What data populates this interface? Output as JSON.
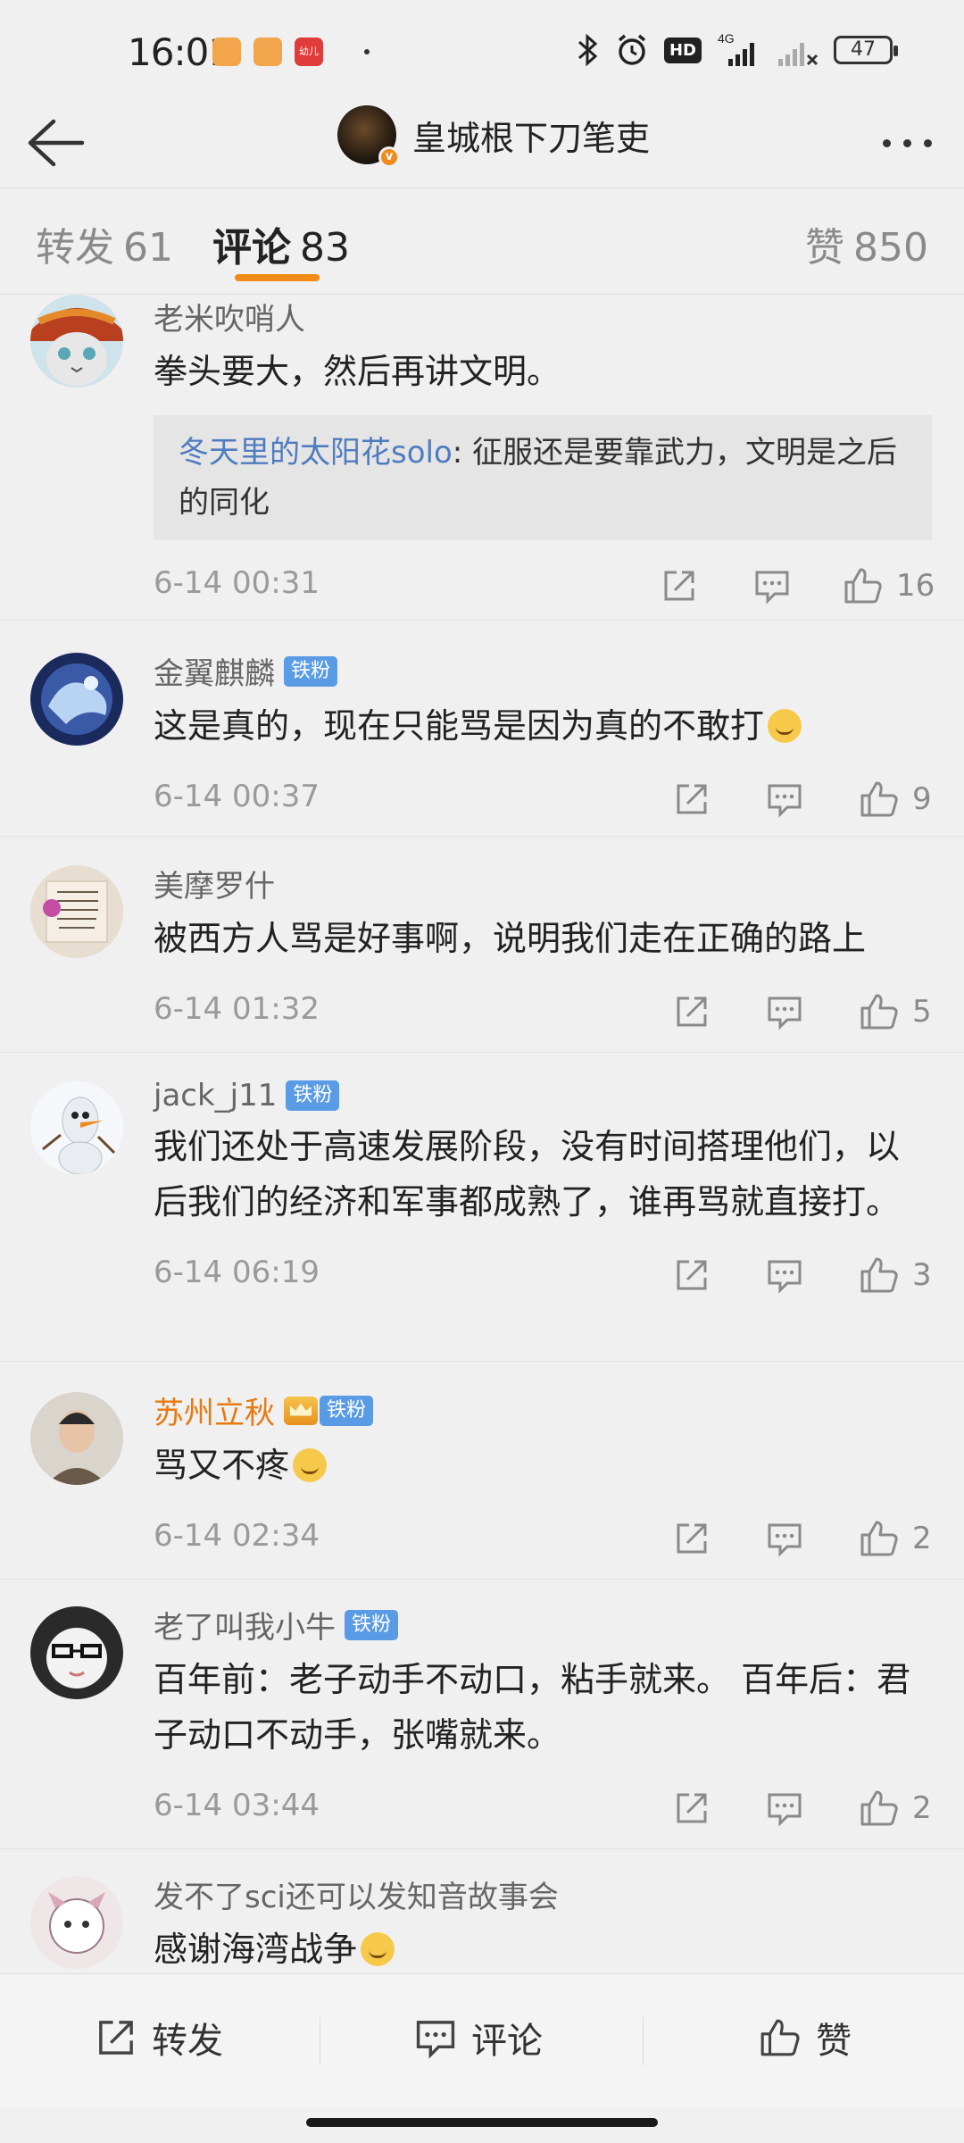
{
  "status_bar": {
    "time": "16:01",
    "app_label": "幼儿",
    "network": "4G",
    "hd": "HD",
    "battery": "47"
  },
  "header": {
    "title": "皇城根下刀笔吏",
    "verified": "v"
  },
  "tabs": [
    {
      "label": "转发",
      "count": "61"
    },
    {
      "label": "评论",
      "count": "83"
    },
    {
      "label": "赞",
      "count": "850"
    }
  ],
  "comments": [
    {
      "user": "老米吹哨人",
      "badge": "",
      "text": "拳头要大，然后再讲文明。",
      "quote_user": "冬天里的太阳花solo",
      "quote_text": ": 征服还是要靠武力，文明是之后的同化",
      "time": "6-14 00:31",
      "likes": "16"
    },
    {
      "user": "金翼麒麟",
      "badge": "铁粉",
      "text": "这是真的，现在只能骂是因为真的不敢打",
      "time": "6-14 00:37",
      "likes": "9"
    },
    {
      "user": "美摩罗什",
      "badge": "",
      "text": "被西方人骂是好事啊，说明我们走在正确的路上",
      "time": "6-14 01:32",
      "likes": "5"
    },
    {
      "user": "jack_j11",
      "badge": "铁粉",
      "text": "我们还处于高速发展阶段，没有时间搭理他们，以后我们的经济和军事都成熟了，谁再骂就直接打。",
      "time": "6-14 06:19",
      "likes": "3"
    },
    {
      "user": "苏州立秋",
      "badge": "铁粉",
      "text": "骂又不疼",
      "time": "6-14 02:34",
      "likes": "2"
    },
    {
      "user": "老了叫我小牛",
      "badge": "铁粉",
      "text": "百年前：老子动手不动口，粘手就来。 百年后：君子动口不动手，张嘴就来。",
      "time": "6-14 03:44",
      "likes": "2"
    },
    {
      "user": "发不了sci还可以发知音故事会",
      "badge": "",
      "text": "感谢海湾战争",
      "time": "",
      "likes": ""
    }
  ],
  "bottom_bar": {
    "repost": "转发",
    "comment": "评论",
    "like": "赞"
  },
  "colors": {
    "accent": "#f28b17",
    "badge": "#5a9be6",
    "quote_user": "#4f7cc0",
    "vip_name": "#e8790f"
  }
}
